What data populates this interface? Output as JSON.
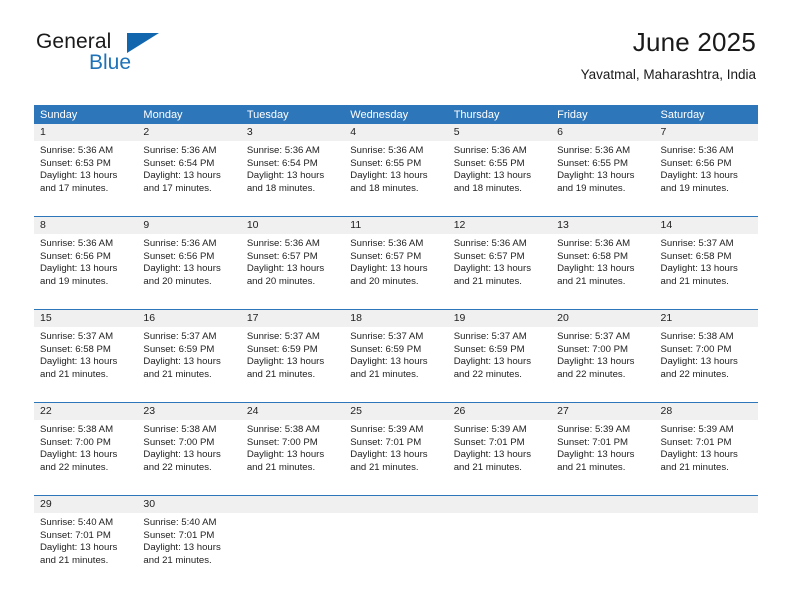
{
  "brand": {
    "word_one": "General",
    "word_two": "Blue",
    "accent_color": "#1166ae",
    "text_color": "#1a1a1a"
  },
  "header": {
    "title": "June 2025",
    "location": "Yavatmal, Maharashtra, India"
  },
  "calendar": {
    "header_color": "#2e76ba",
    "day_band_color": "#f0f0f0",
    "weekday_headers": [
      "Sunday",
      "Monday",
      "Tuesday",
      "Wednesday",
      "Thursday",
      "Friday",
      "Saturday"
    ],
    "weeks": [
      [
        {
          "day": "1",
          "lines": [
            "Sunrise: 5:36 AM",
            "Sunset: 6:53 PM",
            "Daylight: 13 hours",
            "and 17 minutes."
          ]
        },
        {
          "day": "2",
          "lines": [
            "Sunrise: 5:36 AM",
            "Sunset: 6:54 PM",
            "Daylight: 13 hours",
            "and 17 minutes."
          ]
        },
        {
          "day": "3",
          "lines": [
            "Sunrise: 5:36 AM",
            "Sunset: 6:54 PM",
            "Daylight: 13 hours",
            "and 18 minutes."
          ]
        },
        {
          "day": "4",
          "lines": [
            "Sunrise: 5:36 AM",
            "Sunset: 6:55 PM",
            "Daylight: 13 hours",
            "and 18 minutes."
          ]
        },
        {
          "day": "5",
          "lines": [
            "Sunrise: 5:36 AM",
            "Sunset: 6:55 PM",
            "Daylight: 13 hours",
            "and 18 minutes."
          ]
        },
        {
          "day": "6",
          "lines": [
            "Sunrise: 5:36 AM",
            "Sunset: 6:55 PM",
            "Daylight: 13 hours",
            "and 19 minutes."
          ]
        },
        {
          "day": "7",
          "lines": [
            "Sunrise: 5:36 AM",
            "Sunset: 6:56 PM",
            "Daylight: 13 hours",
            "and 19 minutes."
          ]
        }
      ],
      [
        {
          "day": "8",
          "lines": [
            "Sunrise: 5:36 AM",
            "Sunset: 6:56 PM",
            "Daylight: 13 hours",
            "and 19 minutes."
          ]
        },
        {
          "day": "9",
          "lines": [
            "Sunrise: 5:36 AM",
            "Sunset: 6:56 PM",
            "Daylight: 13 hours",
            "and 20 minutes."
          ]
        },
        {
          "day": "10",
          "lines": [
            "Sunrise: 5:36 AM",
            "Sunset: 6:57 PM",
            "Daylight: 13 hours",
            "and 20 minutes."
          ]
        },
        {
          "day": "11",
          "lines": [
            "Sunrise: 5:36 AM",
            "Sunset: 6:57 PM",
            "Daylight: 13 hours",
            "and 20 minutes."
          ]
        },
        {
          "day": "12",
          "lines": [
            "Sunrise: 5:36 AM",
            "Sunset: 6:57 PM",
            "Daylight: 13 hours",
            "and 21 minutes."
          ]
        },
        {
          "day": "13",
          "lines": [
            "Sunrise: 5:36 AM",
            "Sunset: 6:58 PM",
            "Daylight: 13 hours",
            "and 21 minutes."
          ]
        },
        {
          "day": "14",
          "lines": [
            "Sunrise: 5:37 AM",
            "Sunset: 6:58 PM",
            "Daylight: 13 hours",
            "and 21 minutes."
          ]
        }
      ],
      [
        {
          "day": "15",
          "lines": [
            "Sunrise: 5:37 AM",
            "Sunset: 6:58 PM",
            "Daylight: 13 hours",
            "and 21 minutes."
          ]
        },
        {
          "day": "16",
          "lines": [
            "Sunrise: 5:37 AM",
            "Sunset: 6:59 PM",
            "Daylight: 13 hours",
            "and 21 minutes."
          ]
        },
        {
          "day": "17",
          "lines": [
            "Sunrise: 5:37 AM",
            "Sunset: 6:59 PM",
            "Daylight: 13 hours",
            "and 21 minutes."
          ]
        },
        {
          "day": "18",
          "lines": [
            "Sunrise: 5:37 AM",
            "Sunset: 6:59 PM",
            "Daylight: 13 hours",
            "and 21 minutes."
          ]
        },
        {
          "day": "19",
          "lines": [
            "Sunrise: 5:37 AM",
            "Sunset: 6:59 PM",
            "Daylight: 13 hours",
            "and 22 minutes."
          ]
        },
        {
          "day": "20",
          "lines": [
            "Sunrise: 5:37 AM",
            "Sunset: 7:00 PM",
            "Daylight: 13 hours",
            "and 22 minutes."
          ]
        },
        {
          "day": "21",
          "lines": [
            "Sunrise: 5:38 AM",
            "Sunset: 7:00 PM",
            "Daylight: 13 hours",
            "and 22 minutes."
          ]
        }
      ],
      [
        {
          "day": "22",
          "lines": [
            "Sunrise: 5:38 AM",
            "Sunset: 7:00 PM",
            "Daylight: 13 hours",
            "and 22 minutes."
          ]
        },
        {
          "day": "23",
          "lines": [
            "Sunrise: 5:38 AM",
            "Sunset: 7:00 PM",
            "Daylight: 13 hours",
            "and 22 minutes."
          ]
        },
        {
          "day": "24",
          "lines": [
            "Sunrise: 5:38 AM",
            "Sunset: 7:00 PM",
            "Daylight: 13 hours",
            "and 21 minutes."
          ]
        },
        {
          "day": "25",
          "lines": [
            "Sunrise: 5:39 AM",
            "Sunset: 7:01 PM",
            "Daylight: 13 hours",
            "and 21 minutes."
          ]
        },
        {
          "day": "26",
          "lines": [
            "Sunrise: 5:39 AM",
            "Sunset: 7:01 PM",
            "Daylight: 13 hours",
            "and 21 minutes."
          ]
        },
        {
          "day": "27",
          "lines": [
            "Sunrise: 5:39 AM",
            "Sunset: 7:01 PM",
            "Daylight: 13 hours",
            "and 21 minutes."
          ]
        },
        {
          "day": "28",
          "lines": [
            "Sunrise: 5:39 AM",
            "Sunset: 7:01 PM",
            "Daylight: 13 hours",
            "and 21 minutes."
          ]
        }
      ],
      [
        {
          "day": "29",
          "lines": [
            "Sunrise: 5:40 AM",
            "Sunset: 7:01 PM",
            "Daylight: 13 hours",
            "and 21 minutes."
          ]
        },
        {
          "day": "30",
          "lines": [
            "Sunrise: 5:40 AM",
            "Sunset: 7:01 PM",
            "Daylight: 13 hours",
            "and 21 minutes."
          ]
        },
        {
          "day": "",
          "lines": []
        },
        {
          "day": "",
          "lines": []
        },
        {
          "day": "",
          "lines": []
        },
        {
          "day": "",
          "lines": []
        },
        {
          "day": "",
          "lines": []
        }
      ]
    ]
  }
}
